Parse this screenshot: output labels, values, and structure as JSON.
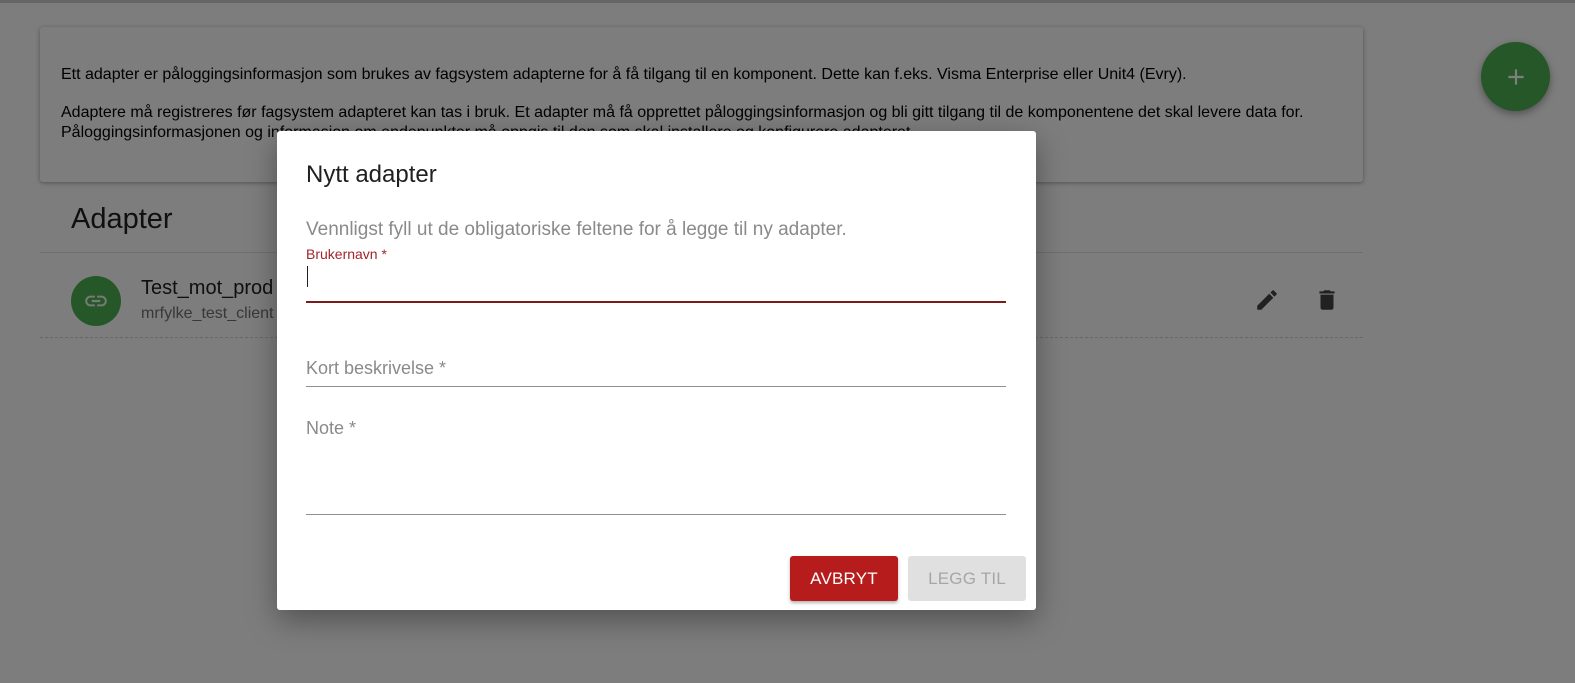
{
  "info": {
    "paragraph1": "Ett adapter er påloggingsinformasjon som brukes av fagsystem adapterne for å få tilgang til en komponent. Dette kan f.eks. Visma Enterprise eller Unit4 (Evry).",
    "paragraph2": "Adaptere må registreres før fagsystem adapteret kan tas i bruk. Et adapter må få opprettet påloggingsinformasjon og bli gitt tilgang til de komponentene det skal levere data for. Påloggingsinformasjonen og informasjon om endepunkter må oppgis til den som skal installere og konfigurere adapteret."
  },
  "adapters": {
    "title": "Adapter",
    "items": [
      {
        "name": "Test_mot_prod",
        "subtitle": "mrfylke_test_client",
        "icon": "link-icon"
      }
    ]
  },
  "actions": {
    "edit_icon": "pencil-icon",
    "delete_icon": "trash-icon",
    "fab_icon": "plus-icon"
  },
  "dialog": {
    "title": "Nytt adapter",
    "description": "Vennligst fyll ut de obligatoriske feltene for å legge til ny adapter.",
    "fields": {
      "username": {
        "label": "Brukernavn *",
        "value": ""
      },
      "short_description": {
        "label": "Kort beskrivelse *",
        "value": ""
      },
      "note": {
        "label": "Note *",
        "value": ""
      }
    },
    "buttons": {
      "cancel": "AVBRYT",
      "add": "LEGG TIL"
    }
  },
  "colors": {
    "accent_green": "#4caf50",
    "cancel_red": "#b71c1c",
    "focus_red": "#7d1a1a",
    "disabled_grey": "#e0e0e0"
  }
}
